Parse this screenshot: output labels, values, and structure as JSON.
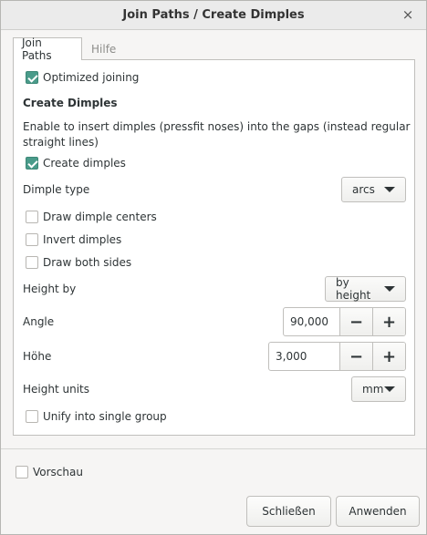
{
  "window": {
    "title": "Join Paths / Create Dimples",
    "close_glyph": "×"
  },
  "tabs": [
    {
      "label": "Join Paths",
      "active": true
    },
    {
      "label": "Hilfe",
      "active": false
    }
  ],
  "panel": {
    "optimized_joining": {
      "label": "Optimized joining",
      "checked": true
    },
    "section_title": "Create Dimples",
    "description_line1": "Enable to insert dimples (pressfit noses) into the gaps (instead regular",
    "description_line2": "straight lines)",
    "create_dimples": {
      "label": "Create dimples",
      "checked": true
    },
    "dimple_type": {
      "label": "Dimple type",
      "value": "arcs"
    },
    "draw_centers": {
      "label": "Draw dimple centers",
      "checked": false
    },
    "invert_dimples": {
      "label": "Invert dimples",
      "checked": false
    },
    "draw_both_sides": {
      "label": "Draw both sides",
      "checked": false
    },
    "height_by": {
      "label": "Height by",
      "value": "by height"
    },
    "angle": {
      "label": "Angle",
      "value": "90,000"
    },
    "hoehe": {
      "label": "Höhe",
      "value": "3,000"
    },
    "height_units": {
      "label": "Height units",
      "value": "mm"
    },
    "unify": {
      "label": "Unify into single group",
      "checked": false
    },
    "minus_glyph": "−",
    "plus_glyph": "+"
  },
  "footer": {
    "preview": {
      "label": "Vorschau",
      "checked": false
    },
    "close_button": "Schließen",
    "apply_button": "Anwenden"
  },
  "colors": {
    "check_accent": "#4a9b8a"
  }
}
